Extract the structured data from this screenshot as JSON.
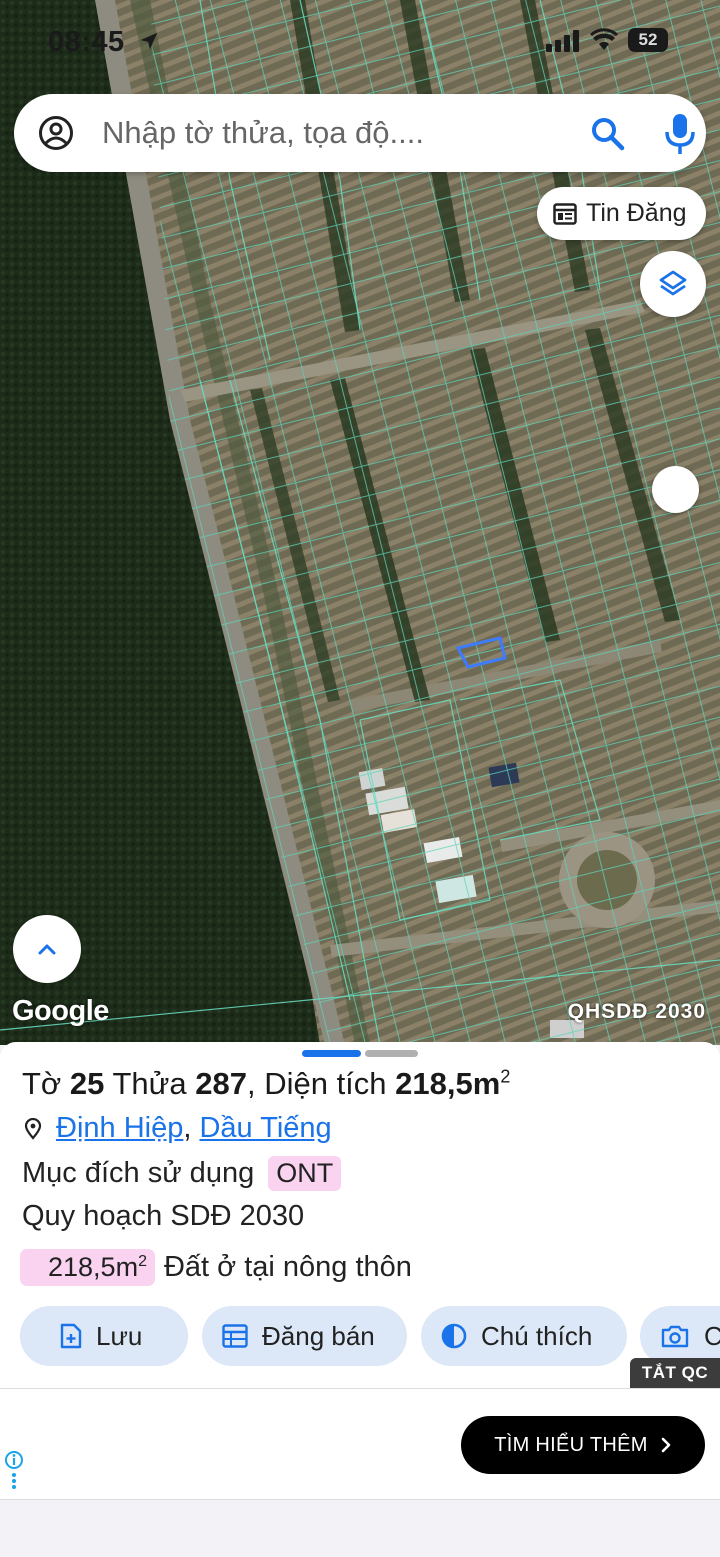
{
  "status_bar": {
    "time": "08:45",
    "battery": "52"
  },
  "search": {
    "placeholder": "Nhập tờ thửa, tọa độ...."
  },
  "map": {
    "tin_dang_label": "Tin Đăng",
    "attribution": "Google",
    "layer_label": "QHSDĐ 2030"
  },
  "parcel": {
    "sheet_label": "Tờ",
    "sheet_no": "25",
    "parcel_label": "Thửa",
    "parcel_no": "287",
    "area_label": "Diện tích",
    "area": "218,5m",
    "area_unit_sup": "2",
    "ward": "Định Hiệp",
    "district": "Dầu Tiếng",
    "purpose_label": "Mục đích sử dụng",
    "purpose_code": "ONT",
    "plan_label": "Quy hoạch SDĐ 2030",
    "zone_area": "218,5m",
    "zone_area_sup": "2",
    "zone_desc": "Đất ở tại nông thôn"
  },
  "actions": {
    "save": "Lưu",
    "post_sale": "Đăng bán",
    "legend": "Chú thích",
    "capture": "C"
  },
  "ad": {
    "close_label": "TẮT QC",
    "cta_label": "TÌM HIỂU THÊM"
  },
  "colors": {
    "accent": "#1a73e8",
    "tag_pink": "#f9d3f0",
    "action_bg": "#dce7f7",
    "parcel_outline": "#3d7cff"
  }
}
